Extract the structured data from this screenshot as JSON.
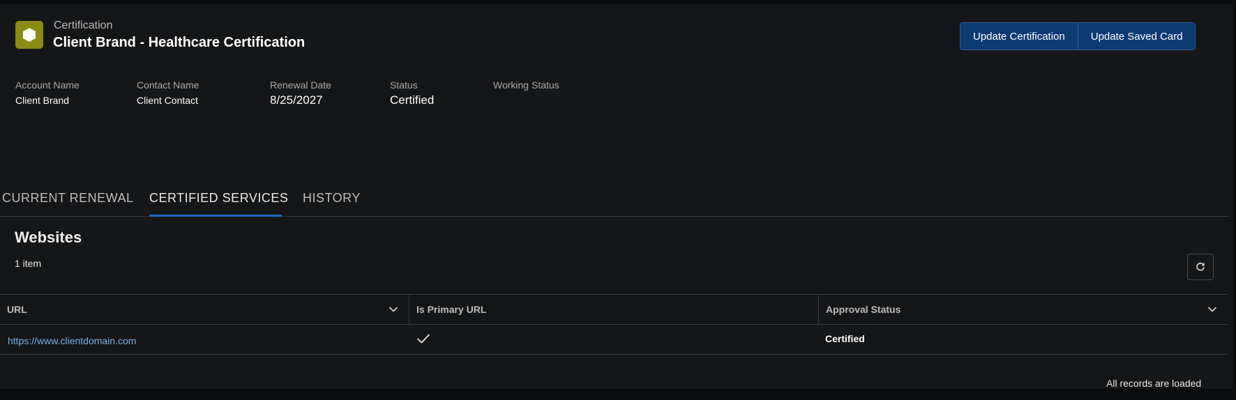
{
  "header": {
    "object_type": "Certification",
    "record_title": "Client Brand - Healthcare Certification",
    "icon": "hexagon-icon",
    "actions": [
      "Update Certification",
      "Update Saved Card"
    ]
  },
  "highlights": {
    "account_name": {
      "label": "Account Name",
      "value": "Client Brand"
    },
    "contact_name": {
      "label": "Contact Name",
      "value": "Client Contact"
    },
    "renewal_date": {
      "label": "Renewal Date",
      "value": "8/25/2027"
    },
    "status": {
      "label": "Status",
      "value": "Certified"
    },
    "working_status": {
      "label": "Working Status",
      "value": ""
    }
  },
  "tabs": [
    {
      "label": "CURRENT RENEWAL",
      "active": false
    },
    {
      "label": "CERTIFIED SERVICES",
      "active": true
    },
    {
      "label": "HISTORY",
      "active": false
    }
  ],
  "websites": {
    "title": "Websites",
    "count": "1 item",
    "columns": [
      "URL",
      "Is Primary URL",
      "Approval Status"
    ],
    "rows": [
      {
        "url": "https://www.clientdomain.com",
        "is_primary": true,
        "approval_status": "Certified"
      }
    ],
    "footer": "All records are loaded"
  },
  "colors": {
    "accent": "#1b6ac9",
    "button_bg": "#0d3a73",
    "icon_bg": "#8b8b16",
    "link": "#79aee8"
  }
}
